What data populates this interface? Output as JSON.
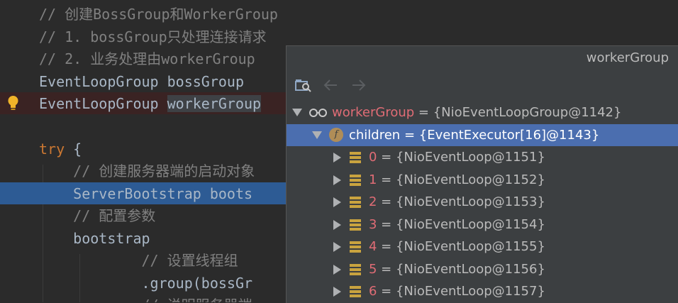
{
  "editor": {
    "lines": [
      {
        "segments": [
          {
            "t": "// 创建BossGroup和WorkerGroup",
            "c": "comment"
          }
        ]
      },
      {
        "segments": [
          {
            "t": "// 1. bossGroup只处理连接请求",
            "c": "comment"
          }
        ]
      },
      {
        "segments": [
          {
            "t": "// 2. 业务处理由workerGroup",
            "c": "comment"
          }
        ]
      },
      {
        "segments": [
          {
            "t": "EventLoopGroup bossGroup",
            "c": ""
          }
        ]
      },
      {
        "segments": [
          {
            "t": "EventLoopGroup ",
            "c": ""
          },
          {
            "t": "workerGroup",
            "c": "hl"
          }
        ]
      },
      {
        "segments": []
      },
      {
        "segments": [
          {
            "t": "try",
            "c": "kw"
          },
          {
            "t": " {",
            "c": ""
          }
        ]
      },
      {
        "segments": [
          {
            "t": "    // 创建服务器端的启动对象",
            "c": "comment"
          }
        ]
      },
      {
        "segments": [
          {
            "t": "    ServerBootstrap boots",
            "c": ""
          }
        ]
      },
      {
        "segments": [
          {
            "t": "    // 配置参数",
            "c": "comment"
          }
        ]
      },
      {
        "segments": [
          {
            "t": "    bootstrap",
            "c": ""
          }
        ]
      },
      {
        "segments": [
          {
            "t": "            // 设置线程组",
            "c": "comment"
          }
        ]
      },
      {
        "segments": [
          {
            "t": "            .group(bossGr",
            "c": ""
          }
        ]
      },
      {
        "segments": [
          {
            "t": "            // 说明服务器端",
            "c": "comment"
          }
        ]
      }
    ]
  },
  "popup": {
    "title": "workerGroup",
    "tree": [
      {
        "name": "workerGroup",
        "value": "{NioEventLoopGroup@1142}",
        "expanded": true,
        "icon": "watch-icon"
      },
      {
        "name": "children",
        "value": "{EventExecutor[16]@1143}",
        "expanded": true,
        "icon": "field-icon",
        "selected": true
      },
      {
        "name": "0",
        "value": "{NioEventLoop@1151}",
        "expanded": false,
        "icon": "array-element-icon"
      },
      {
        "name": "1",
        "value": "{NioEventLoop@1152}",
        "expanded": false,
        "icon": "array-element-icon"
      },
      {
        "name": "2",
        "value": "{NioEventLoop@1153}",
        "expanded": false,
        "icon": "array-element-icon"
      },
      {
        "name": "3",
        "value": "{NioEventLoop@1154}",
        "expanded": false,
        "icon": "array-element-icon"
      },
      {
        "name": "4",
        "value": "{NioEventLoop@1155}",
        "expanded": false,
        "icon": "array-element-icon"
      },
      {
        "name": "5",
        "value": "{NioEventLoop@1156}",
        "expanded": false,
        "icon": "array-element-icon"
      },
      {
        "name": "6",
        "value": "{NioEventLoop@1157}",
        "expanded": false,
        "icon": "array-element-icon"
      }
    ]
  },
  "colors": {
    "accent": "#4b6eaf",
    "error_line": "#3a2323",
    "execution_line": "#2d5b94"
  }
}
